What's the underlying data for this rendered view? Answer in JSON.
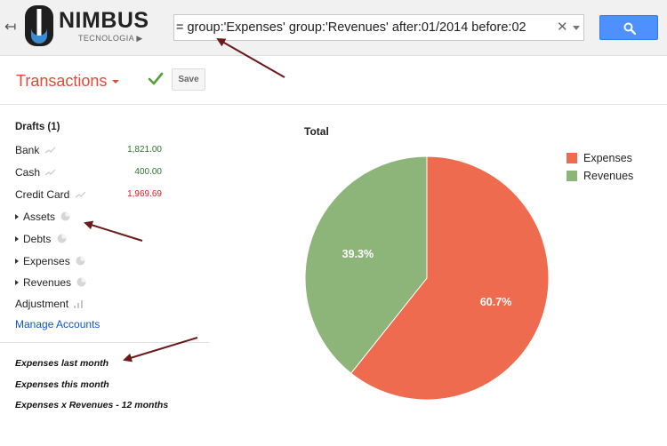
{
  "header": {
    "back_icon": "back-arrow-icon",
    "logo_name": "NIMBUS",
    "logo_subtitle": "TECNOLOGIA",
    "logo_subtitle_glyph": "▶",
    "search_value": "= group:'Expenses' group:'Revenues' after:01/2014 before:02",
    "clear_glyph": "✕",
    "search_icon": "magnifier-icon"
  },
  "toolbar": {
    "title": "Transactions",
    "save_label": "Save",
    "check_icon": "checkmark-icon"
  },
  "sidebar": {
    "drafts": "Drafts (1)",
    "accounts": [
      {
        "label": "Bank",
        "amount": "1,821.00",
        "sign": "positive",
        "icon": "sparkline-icon"
      },
      {
        "label": "Cash",
        "amount": "400.00",
        "sign": "positive",
        "icon": "sparkline-icon"
      },
      {
        "label": "Credit Card",
        "amount": "1,969.69",
        "sign": "negative",
        "icon": "sparkline-icon"
      }
    ],
    "groups": [
      {
        "label": "Assets",
        "icon": "pie-icon"
      },
      {
        "label": "Debts",
        "icon": "pie-icon"
      },
      {
        "label": "Expenses",
        "icon": "pie-icon"
      },
      {
        "label": "Revenues",
        "icon": "pie-icon"
      }
    ],
    "adjustment": "Adjustment",
    "adjustment_icon": "bar-chart-icon",
    "manage_accounts": "Manage Accounts",
    "reports": [
      "Expenses last month",
      "Expenses this month",
      "Expenses x Revenues - 12 months"
    ]
  },
  "chart_data": {
    "type": "pie",
    "title": "Total",
    "labels": [
      "Expenses",
      "Revenues"
    ],
    "values": [
      60.7,
      39.3
    ],
    "value_labels": [
      "60.7%",
      "39.3%"
    ],
    "colors": [
      "#ef6b4f",
      "#8db57a"
    ],
    "legend_position": "right"
  },
  "colors": {
    "accent_red": "#dd4b39",
    "search_blue": "#4d90fe",
    "link_blue": "#1155cc",
    "positive_amount": "#2d7a2d",
    "negative_amount": "#dd2222"
  }
}
